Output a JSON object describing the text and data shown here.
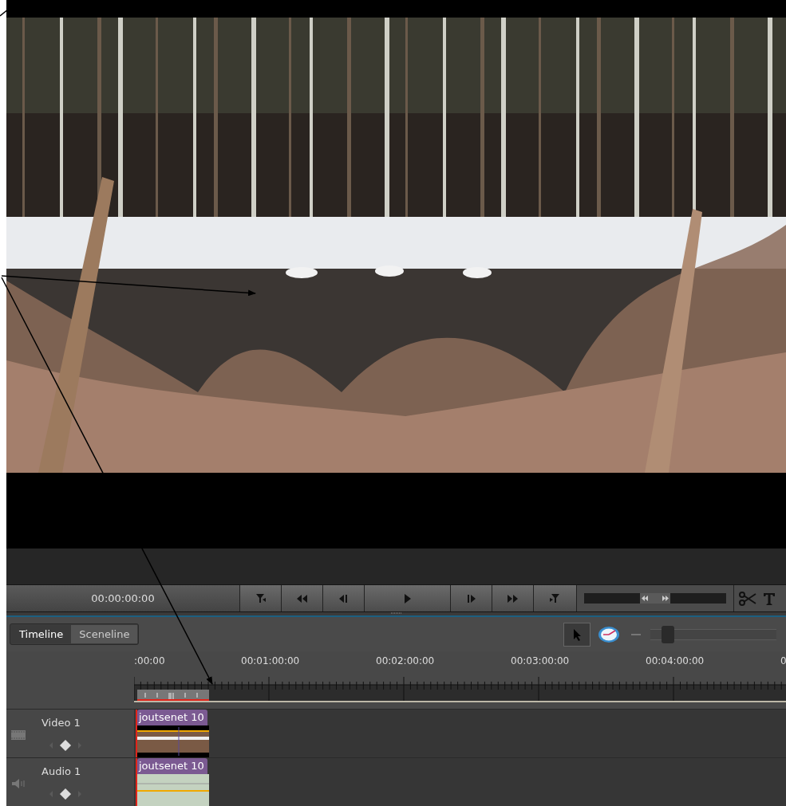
{
  "timecode": "00:00:00:00",
  "view_tabs": [
    {
      "label": "Timeline",
      "selected": true
    },
    {
      "label": "Sceneline",
      "selected": false
    }
  ],
  "jog": {
    "level": 0.5
  },
  "zoom": {
    "level": 0.1
  },
  "ruler": {
    "labels": [
      ":00:00",
      "00:01:00:00",
      "00:02:00:00",
      "00:03:00:00",
      "00:04:00:00",
      "0"
    ]
  },
  "tracks": [
    {
      "name": "Video 1",
      "kind": "video",
      "clip": "joutsenet 10"
    },
    {
      "name": "Audio 1",
      "kind": "audio",
      "clip": "joutsenet 10"
    }
  ]
}
